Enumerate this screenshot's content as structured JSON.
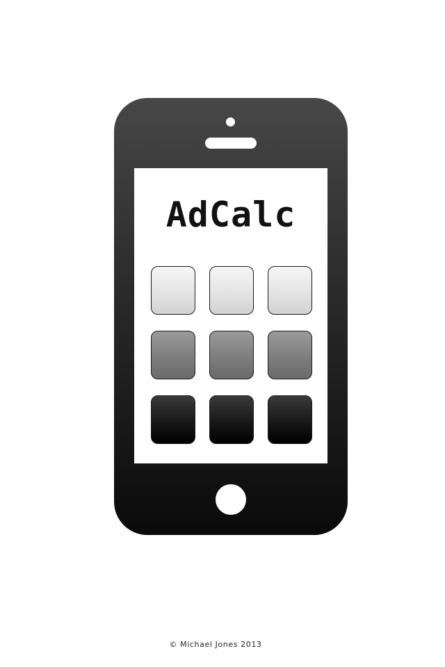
{
  "app": {
    "title": "AdCalc"
  },
  "icons": {
    "camera": "camera-icon",
    "speaker": "speaker-icon",
    "home": "home-button-icon"
  },
  "tiles": [
    {
      "row": 1,
      "shade": "light"
    },
    {
      "row": 1,
      "shade": "light"
    },
    {
      "row": 1,
      "shade": "light"
    },
    {
      "row": 2,
      "shade": "mid"
    },
    {
      "row": 2,
      "shade": "mid"
    },
    {
      "row": 2,
      "shade": "mid"
    },
    {
      "row": 3,
      "shade": "dark"
    },
    {
      "row": 3,
      "shade": "dark"
    },
    {
      "row": 3,
      "shade": "dark"
    }
  ],
  "colors": {
    "phone_body": "#2a2a2a",
    "screen": "#ffffff"
  },
  "footer": {
    "copyright": "© Michael Jones 2013"
  }
}
